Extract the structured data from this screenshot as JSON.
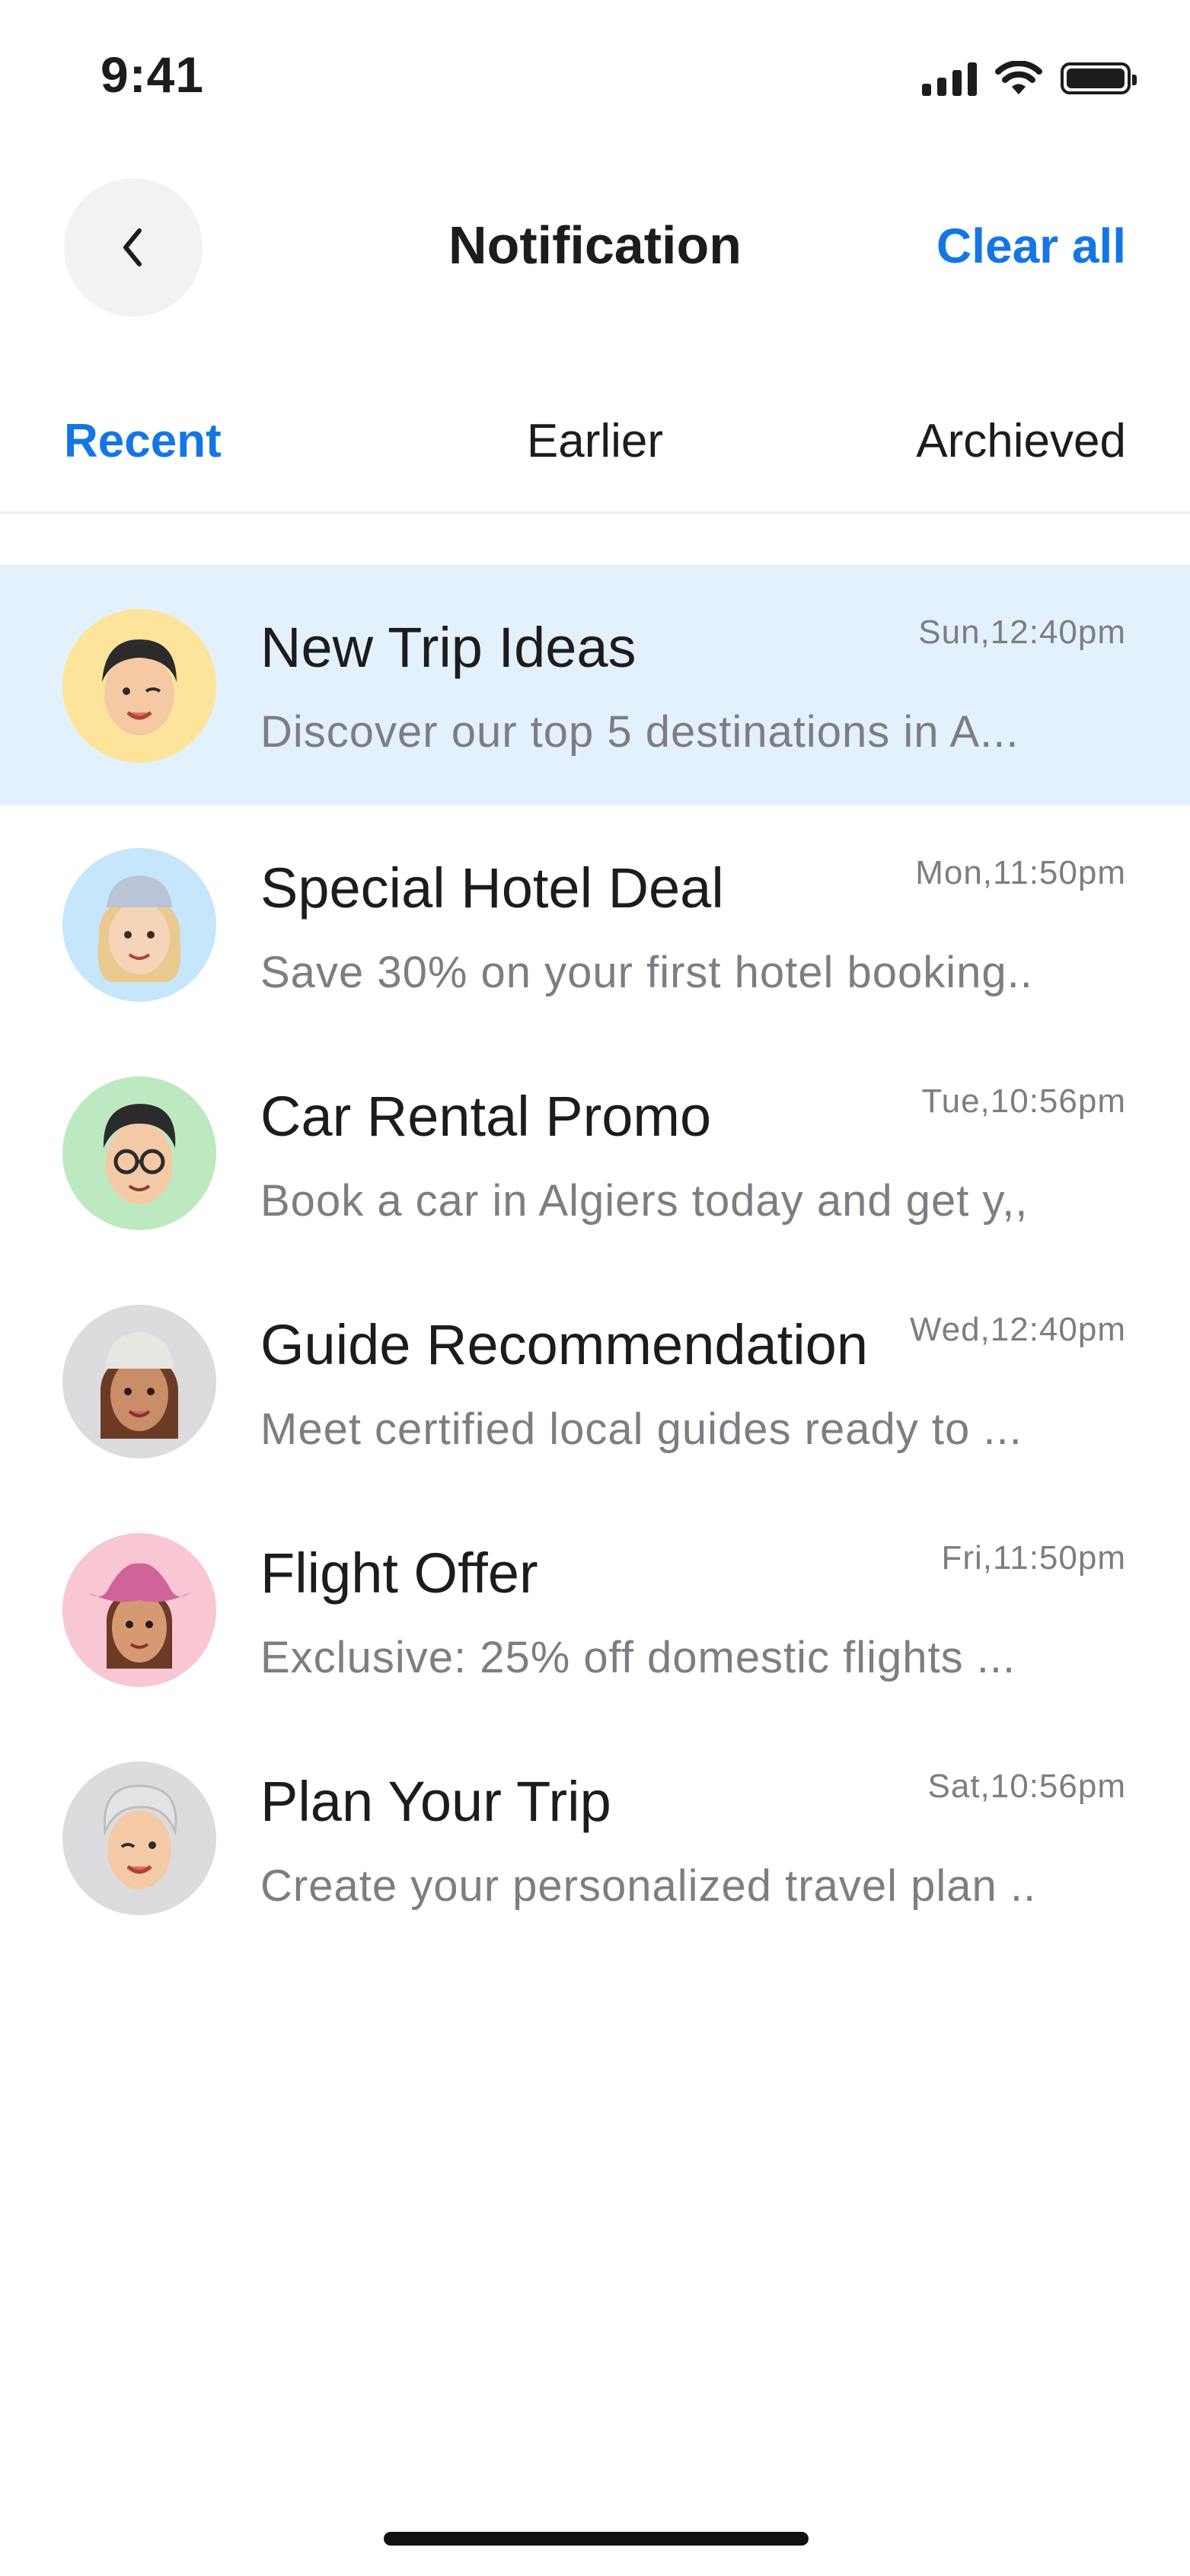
{
  "status_bar": {
    "time": "9:41"
  },
  "header": {
    "title": "Notification",
    "clear_label": "Clear all",
    "back_icon": "chevron-left-icon"
  },
  "tabs": [
    {
      "label": "Recent",
      "active": true
    },
    {
      "label": "Earlier",
      "active": false
    },
    {
      "label": "Archieved",
      "active": false
    }
  ],
  "colors": {
    "accent": "#1476e5",
    "highlight": "#e3f1fc",
    "secondary_text": "#7d7d84"
  },
  "notifications": [
    {
      "title": "New Trip Ideas",
      "preview": "Discover our top 5 destinations in A...",
      "time": "Sun,12:40pm",
      "avatar_bg": "#fde49a",
      "highlighted": true
    },
    {
      "title": "Special Hotel Deal",
      "preview": "Save 30% on your first hotel booking..",
      "time": "Mon,11:50pm",
      "avatar_bg": "#c6e6fb",
      "highlighted": false
    },
    {
      "title": "Car Rental Promo",
      "preview": "Book a car in Algiers today and get  y,,",
      "time": "Tue,10:56pm",
      "avatar_bg": "#bde9c0",
      "highlighted": false
    },
    {
      "title": "Guide Recommendation",
      "preview": "Meet certified local guides ready to ...",
      "time": "Wed,12:40pm",
      "avatar_bg": "#dcdcde",
      "highlighted": false
    },
    {
      "title": "Flight Offer",
      "preview": "Exclusive: 25% off domestic flights ...",
      "time": "Fri,11:50pm",
      "avatar_bg": "#f9c6d3",
      "highlighted": false
    },
    {
      "title": "Plan Your Trip",
      "preview": "Create your personalized travel plan ..",
      "time": "Sat,10:56pm",
      "avatar_bg": "#dcdcde",
      "highlighted": false
    }
  ]
}
